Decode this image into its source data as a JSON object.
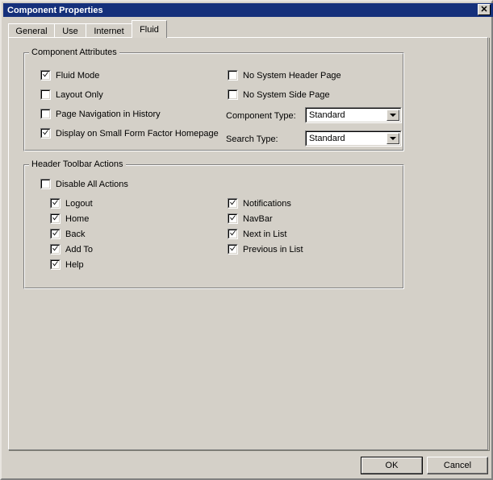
{
  "window": {
    "title": "Component Properties",
    "close_label": "✕"
  },
  "tabs": [
    {
      "label": "General",
      "active": false
    },
    {
      "label": "Use",
      "active": false
    },
    {
      "label": "Internet",
      "active": false
    },
    {
      "label": "Fluid",
      "active": true
    }
  ],
  "component_attributes": {
    "title": "Component Attributes",
    "left_checkboxes": [
      {
        "label": "Fluid Mode",
        "checked": true
      },
      {
        "label": "Layout Only",
        "checked": false
      },
      {
        "label": "Page Navigation in History",
        "checked": false
      },
      {
        "label": "Display on Small Form Factor Homepage",
        "checked": true
      }
    ],
    "right_checkboxes": [
      {
        "label": "No System Header Page",
        "checked": false
      },
      {
        "label": "No System Side Page",
        "checked": false
      }
    ],
    "component_type": {
      "label": "Component Type:",
      "value": "Standard"
    },
    "search_type": {
      "label": "Search Type:",
      "value": "Standard"
    }
  },
  "header_toolbar_actions": {
    "title": "Header Toolbar Actions",
    "disable_all": {
      "label": "Disable All Actions",
      "checked": false
    },
    "left_checkboxes": [
      {
        "label": "Logout",
        "checked": true
      },
      {
        "label": "Home",
        "checked": true
      },
      {
        "label": "Back",
        "checked": true
      },
      {
        "label": "Add To",
        "checked": true
      },
      {
        "label": "Help",
        "checked": true
      }
    ],
    "right_checkboxes": [
      {
        "label": "Notifications",
        "checked": true
      },
      {
        "label": "NavBar",
        "checked": true
      },
      {
        "label": "Next in List",
        "checked": true
      },
      {
        "label": "Previous in List",
        "checked": true
      }
    ]
  },
  "footer": {
    "ok_label": "OK",
    "cancel_label": "Cancel"
  },
  "colors": {
    "face": "#d4d0c8",
    "titlebar": "#15307b",
    "title_text": "#ffffff",
    "field": "#ffffff"
  }
}
